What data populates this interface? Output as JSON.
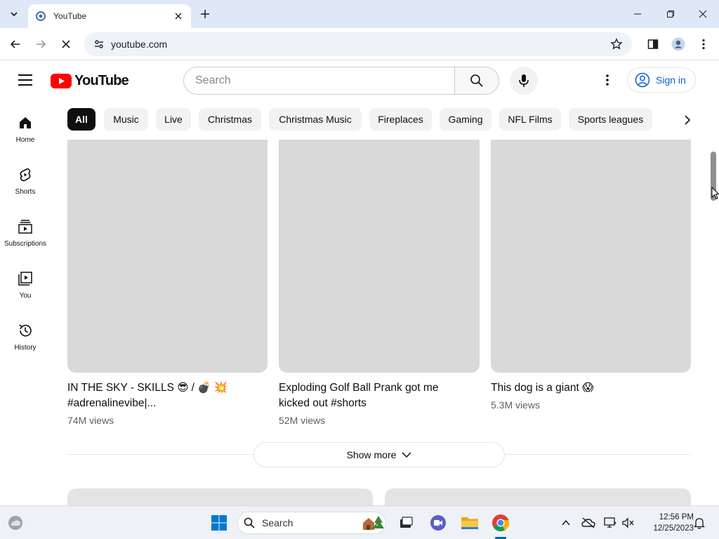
{
  "browser": {
    "tab_title": "YouTube",
    "url": "youtube.com"
  },
  "masthead": {
    "logo_text": "YouTube",
    "search_placeholder": "Search",
    "signin_label": "Sign in"
  },
  "sidebar": {
    "items": [
      {
        "label": "Home",
        "icon": "home-icon"
      },
      {
        "label": "Shorts",
        "icon": "shorts-icon"
      },
      {
        "label": "Subscriptions",
        "icon": "subscriptions-icon"
      },
      {
        "label": "You",
        "icon": "you-icon"
      },
      {
        "label": "History",
        "icon": "history-icon"
      }
    ]
  },
  "chips": [
    "All",
    "Music",
    "Live",
    "Christmas",
    "Christmas Music",
    "Fireplaces",
    "Gaming",
    "NFL Films",
    "Sports leagues"
  ],
  "videos": [
    {
      "title_line1": "IN THE SKY - SKILLS 😎 / 💣 💥",
      "title_line2": "#adrenalinevibe|...",
      "views": "74M views"
    },
    {
      "title_line1": "Exploding Golf Ball Prank got me",
      "title_line2": "kicked out #shorts",
      "views": "52M views"
    },
    {
      "title_line1": "This dog is a giant 😱",
      "title_line2": "",
      "views": "5.3M views"
    }
  ],
  "show_more_label": "Show more",
  "taskbar": {
    "search_label": "Search",
    "time": "12:56 PM",
    "date": "12/25/2023"
  },
  "colors": {
    "youtube_red": "#ff0000",
    "link_blue": "#065fd4",
    "chip_active": "#0f0f0f",
    "thumb_placeholder": "#d9d9d9"
  }
}
